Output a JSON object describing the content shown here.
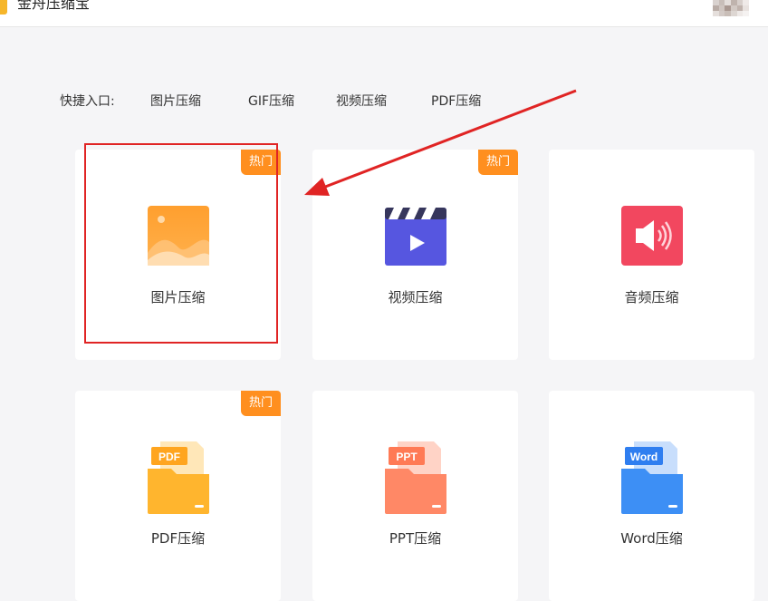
{
  "app": {
    "title": "金舟压缩宝"
  },
  "quick_access": {
    "label": "快捷入口:",
    "links": [
      "图片压缩",
      "GIF压缩",
      "视频压缩",
      "PDF压缩"
    ]
  },
  "cards": [
    {
      "label": "图片压缩",
      "badge": "热门",
      "icon": "image-icon"
    },
    {
      "label": "视频压缩",
      "badge": "热门",
      "icon": "video-icon"
    },
    {
      "label": "音频压缩",
      "badge": "",
      "icon": "audio-icon"
    },
    {
      "label": "PDF压缩",
      "badge": "热门",
      "icon": "pdf-folder-icon",
      "icon_text": "PDF"
    },
    {
      "label": "PPT压缩",
      "badge": "",
      "icon": "ppt-folder-icon",
      "icon_text": "PPT"
    },
    {
      "label": "Word压缩",
      "badge": "",
      "icon": "word-folder-icon",
      "icon_text": "Word"
    }
  ],
  "colors": {
    "badge": "#ff8f1f",
    "image": "#ff9a2e",
    "video": "#5a5ae6",
    "audio": "#f04760",
    "pdf": "#ffb52e",
    "ppt": "#ff8866",
    "word": "#3d8ff5",
    "annotation": "#e02424"
  }
}
